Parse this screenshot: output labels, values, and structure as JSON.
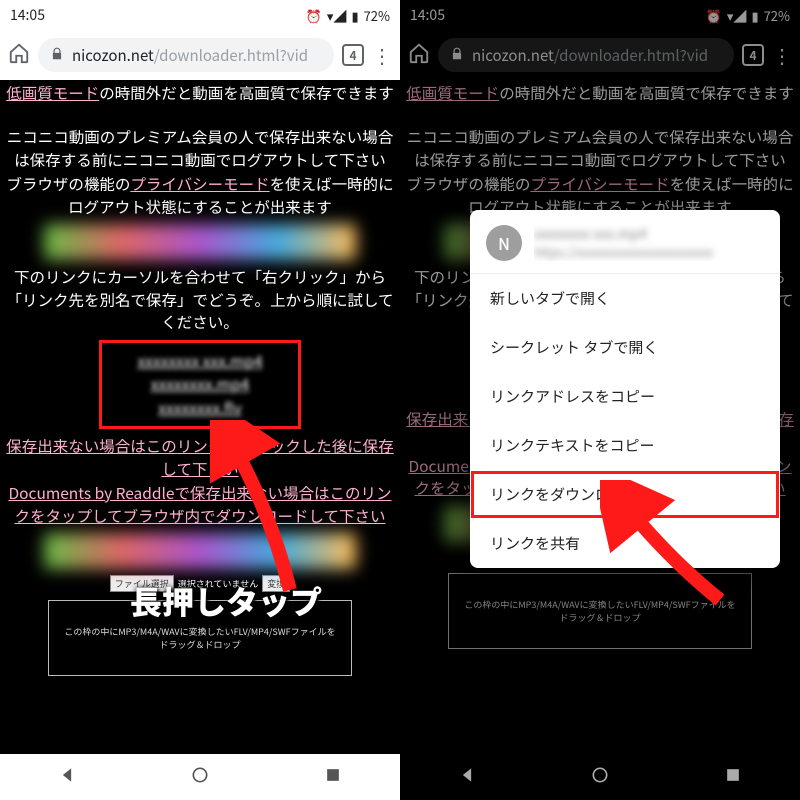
{
  "status": {
    "time": "14:05",
    "battery": "72%"
  },
  "url": {
    "domain": "nicozon.net",
    "path": "/downloader.html?vid",
    "tabs": "4"
  },
  "content": {
    "line1_link": "低画質モード",
    "line1_rest": "の時間外だと動画を高画質で保存できます",
    "para1": "ニコニコ動画のプレミアム会員の人で保存出来ない場合は保存する前にニコニコ動画でログアウトして下さい",
    "para2_a": "ブラウザの機能の",
    "para2_link": "プライバシーモード",
    "para2_b": "を使えば一時的にログアウト状態にすることが出来ます",
    "para3": "下のリンクにカーソルを合わせて「右クリック」から「リンク先を別名で保存」でどうぞ。上から順に試してください。",
    "link_ext1": ".mp4",
    "link_ext2": ".mp4",
    "link_ext3": ".flv",
    "para4_link": "保存出来ない場合はこのリンクをクリックした後に保存して下さい",
    "para5_pre": "Documents by Readdle",
    "para5_rest": "で保存出来ない場合はこのリンクをタップしてブラウザ内でダウンロードして下さい",
    "file_select": "ファイル選択",
    "file_none": "選択されていません",
    "file_convert": "変換",
    "drop_text": "この枠の中にMP3/M4A/WAVに変換したいFLV/MP4/SWFファイルをドラッグ＆ドロップ"
  },
  "annotation": {
    "long_press": "長押しタップ"
  },
  "context_menu": {
    "avatar_letter": "N",
    "title_suffix": ".mp4",
    "url_prefix": "https://",
    "items": [
      "新しいタブで開く",
      "シークレット タブで開く",
      "リンクアドレスをコピー",
      "リンクテキストをコピー",
      "リンクをダウンロード",
      "リンクを共有"
    ],
    "highlight_index": 4
  }
}
